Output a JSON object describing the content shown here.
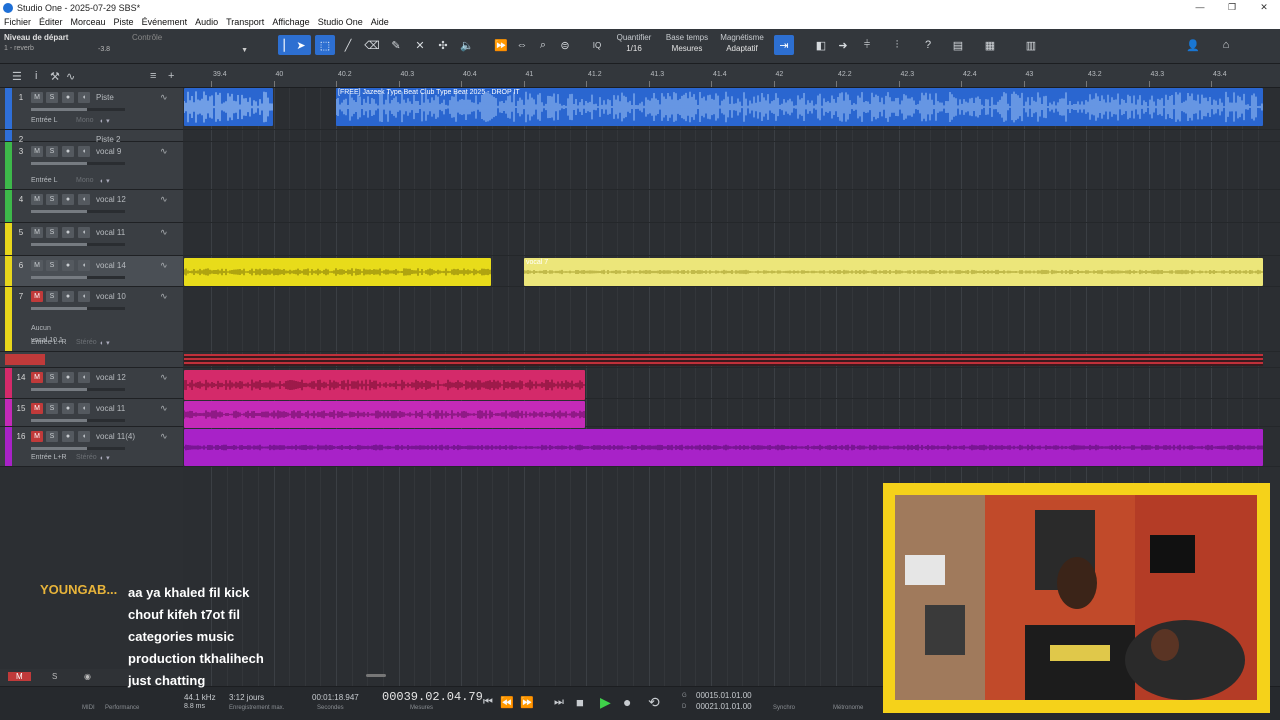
{
  "window": {
    "title": "Studio One - 2025-07-29 SBS*",
    "controls": [
      "—",
      "❐",
      "✕"
    ]
  },
  "menu": [
    "Fichier",
    "Éditer",
    "Morceau",
    "Piste",
    "Événement",
    "Audio",
    "Transport",
    "Affichage",
    "Studio One",
    "Aide"
  ],
  "toolbar": {
    "start_level_label": "Niveau de départ",
    "control_label": "Contrôle",
    "preset": "1 - reverb",
    "gain": "-3.8",
    "quantize_label": "Quantifier",
    "quantize_value": "1/16",
    "timebase_label": "Base temps",
    "timebase_value": "Mesures",
    "snap_label": "Magnétisme",
    "snap_value": "Adaptatif",
    "iq_label": "IQ"
  },
  "ruler": {
    "ticks": [
      "39.4",
      "40",
      "40.2",
      "40.3",
      "40.4",
      "41",
      "41.2",
      "41.3",
      "41.4",
      "42",
      "42.2",
      "42.3",
      "42.4",
      "43",
      "43.2",
      "43.3",
      "43.4"
    ]
  },
  "tracks": [
    {
      "num": "1",
      "name": "Piste",
      "color": "#2f6fd8",
      "mute": false,
      "input": "Entrée L",
      "mono": "Mono"
    },
    {
      "num": "2",
      "name": "Piste 2",
      "color": "#2f6fd8",
      "mute": false
    },
    {
      "num": "3",
      "name": "vocal 9",
      "color": "#3db84a",
      "mute": false,
      "input": "Entrée L",
      "mono": "Mono"
    },
    {
      "num": "4",
      "name": "vocal 12",
      "color": "#3db84a",
      "mute": false
    },
    {
      "num": "5",
      "name": "vocal 11",
      "color": "#e8d61c",
      "mute": false
    },
    {
      "num": "6",
      "name": "vocal 14",
      "color": "#e8d61c",
      "mute": false
    },
    {
      "num": "7",
      "name": "vocal 10",
      "color": "#e8d61c",
      "mute": true,
      "input": "Entrée L+R",
      "mono": "Stéréo",
      "extra1": "Aucun",
      "extra2": "vocal 10.1"
    },
    {
      "num": "14",
      "name": "vocal 12",
      "color": "#d42a6a",
      "mute": true
    },
    {
      "num": "15",
      "name": "vocal 11",
      "color": "#c42ab8",
      "mute": true
    },
    {
      "num": "16",
      "name": "vocal 11(4)",
      "color": "#a822c8",
      "mute": true,
      "input": "Entrée L+R",
      "mono": "Stéréo"
    }
  ],
  "clips": {
    "beat_label": "[FREE] Jazeek Type Beat  Club Type Beat 2025 - DROP IT",
    "vocal7_label": "vocal 7"
  },
  "transport": {
    "sample_rate": "44.1 kHz",
    "latency": "8.8 ms",
    "record_time": "3:12 jours",
    "record_label": "Enregistrement max.",
    "seconds": "00:01:18.947",
    "seconds_label": "Secondes",
    "position": "00039.02.04.79",
    "position_label": "Mesures",
    "loop_start": "00015.01.01.00",
    "loop_end": "00021.01.01.00",
    "midi_label": "MIDI",
    "perf_label": "Performance",
    "sync_label": "Synchro",
    "metro_label": "Métronome",
    "g_label": "G",
    "d_label": "D"
  },
  "bottom": {
    "m": "M",
    "s": "S"
  },
  "chat": {
    "user": "YOUNGAB...",
    "message": "aa ya khaled fil kick chouf kifeh t7ot fil categories music production tkhalihech just chatting"
  }
}
